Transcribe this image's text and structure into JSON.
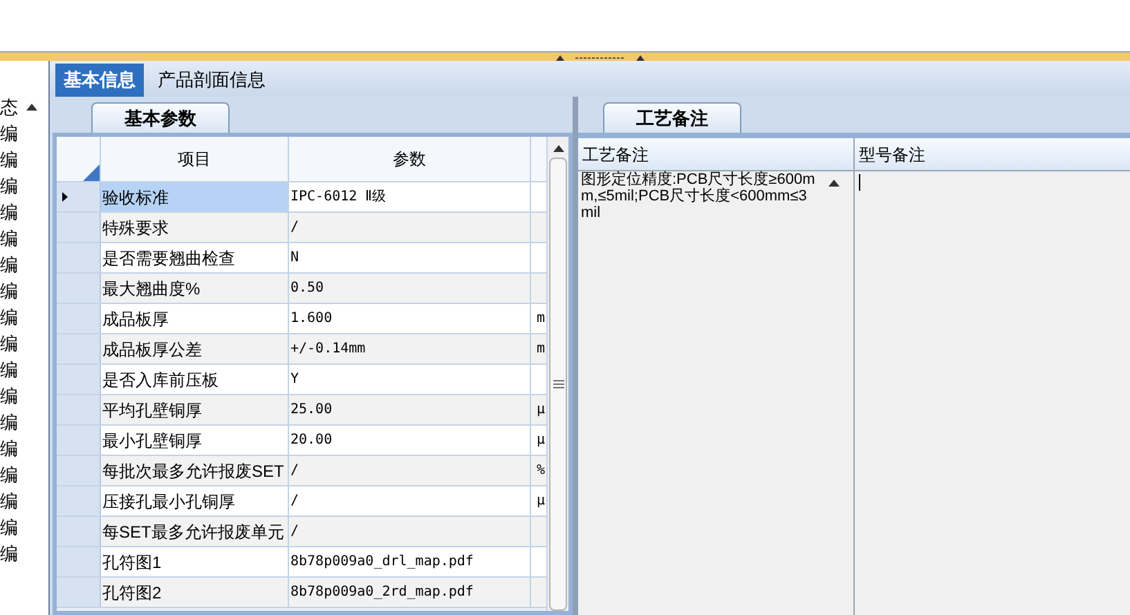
{
  "left_list": {
    "header": "态",
    "items": [
      "编",
      "编",
      "编",
      "编",
      "编",
      "编",
      "编",
      "编",
      "编",
      "编",
      "编",
      "编",
      "编",
      "编",
      "编",
      "编",
      "编"
    ]
  },
  "tabs": [
    {
      "label": "基本信息",
      "selected": true
    },
    {
      "label": "产品剖面信息",
      "selected": false
    }
  ],
  "params": {
    "tab": "基本参数",
    "columns": [
      "项目",
      "参数"
    ],
    "rows": [
      {
        "item": "验收标准",
        "value": "IPC-6012 Ⅱ级",
        "unit": "",
        "selected": true
      },
      {
        "item": "特殊要求",
        "value": "/",
        "unit": "",
        "selected": false
      },
      {
        "item": "是否需要翘曲检查",
        "value": "N",
        "unit": "",
        "selected": false
      },
      {
        "item": "最大翘曲度%",
        "value": "0.50",
        "unit": "",
        "selected": false
      },
      {
        "item": "成品板厚",
        "value": "1.600",
        "unit": "m",
        "selected": false
      },
      {
        "item": "成品板厚公差",
        "value": "+/-0.14mm",
        "unit": "m",
        "selected": false
      },
      {
        "item": "是否入库前压板",
        "value": "Y",
        "unit": "",
        "selected": false
      },
      {
        "item": "平均孔壁铜厚",
        "value": "25.00",
        "unit": "μ",
        "selected": false
      },
      {
        "item": "最小孔壁铜厚",
        "value": "20.00",
        "unit": "μ",
        "selected": false
      },
      {
        "item": "每批次最多允许报废SET",
        "value": "/",
        "unit": "%",
        "selected": false
      },
      {
        "item": "压接孔最小孔铜厚",
        "value": "/",
        "unit": "μ",
        "selected": false
      },
      {
        "item": "每SET最多允许报废单元",
        "value": "/",
        "unit": "",
        "selected": false
      },
      {
        "item": "孔符图1",
        "value": "8b78p009a0_drl_map.pdf",
        "unit": "",
        "selected": false
      },
      {
        "item": "孔符图2",
        "value": "8b78p009a0_2rd_map.pdf",
        "unit": "",
        "selected": false
      }
    ]
  },
  "notes": {
    "tab": "工艺备注",
    "columns": [
      "工艺备注",
      "型号备注"
    ],
    "process_note": "图形定位精度:PCB尺寸长度≥600mm,≤5mil;PCB尺寸长度<600mm≤3mil"
  }
}
